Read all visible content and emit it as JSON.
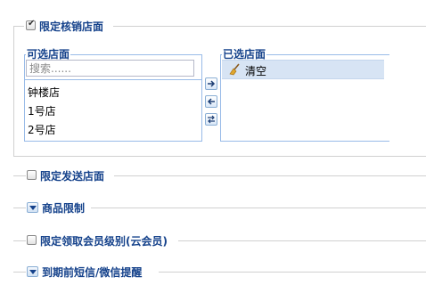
{
  "restrict_store": {
    "checked": true,
    "label": "限定核销店面",
    "available": {
      "title": "可选店面",
      "search_placeholder": "搜索......",
      "items": [
        "钟楼店",
        "1号店",
        "2号店"
      ]
    },
    "selected": {
      "title": "已选店面",
      "clear_label": "清空"
    }
  },
  "sections": [
    {
      "type": "checkbox",
      "label": "限定发送店面"
    },
    {
      "type": "toggle",
      "label": "商品限制"
    },
    {
      "type": "checkbox",
      "label": "限定领取会员级别(云会员)"
    },
    {
      "type": "toggle",
      "label": "到期前短信/微信提醒"
    }
  ],
  "colors": {
    "legend_text": "#15428b",
    "panel_border": "#99bbe8",
    "selected_row": "#d7e4f4"
  }
}
